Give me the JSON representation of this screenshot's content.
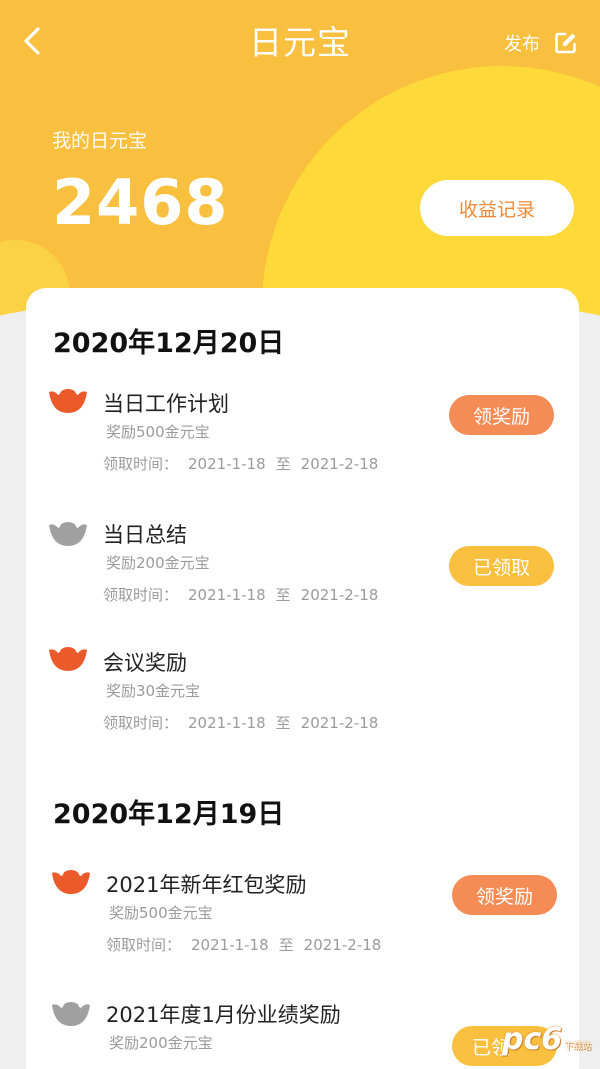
{
  "header": {
    "title": "日元宝",
    "publish_label": "发布",
    "balance_label": "我的日元宝",
    "balance_value": "2468",
    "earnings_button": "收益记录"
  },
  "colors": {
    "primary": "#f9bf3f",
    "highlight": "#fdd939",
    "claim": "#f58b55",
    "claimed": "#f9bf3f",
    "ingot_active": "#ea5a2a",
    "ingot_inactive": "#a0a0a0"
  },
  "groups": [
    {
      "date": "2020年12月20日",
      "items": [
        {
          "title": "当日工作计划",
          "reward": "奖励500金元宝",
          "time_label": "领取时间：",
          "start": "2021-1-18",
          "sep": "至",
          "end": "2021-2-18",
          "action": "领奖励",
          "status": "claim",
          "icon": "ingot-red-icon"
        },
        {
          "title": "当日总结",
          "reward": "奖励200金元宝",
          "time_label": "领取时间：",
          "start": "2021-1-18",
          "sep": "至",
          "end": "2021-2-18",
          "action": "已领取",
          "status": "claimed",
          "icon": "ingot-gray-icon"
        },
        {
          "title": "会议奖励",
          "reward": "奖励30金元宝",
          "time_label": "领取时间：",
          "start": "2021-1-18",
          "sep": "至",
          "end": "2021-2-18",
          "action": "",
          "status": "none",
          "icon": "ingot-red-icon"
        }
      ]
    },
    {
      "date": "2020年12月19日",
      "items": [
        {
          "title": "2021年新年红包奖励",
          "reward": "奖励500金元宝",
          "time_label": "领取时间：",
          "start": "2021-1-18",
          "sep": "至",
          "end": "2021-2-18",
          "action": "领奖励",
          "status": "claim",
          "icon": "ingot-red-icon"
        },
        {
          "title": "2021年度1月份业绩奖励",
          "reward": "奖励200金元宝",
          "time_label": "",
          "start": "",
          "sep": "",
          "end": "",
          "action": "已领",
          "status": "claimed",
          "icon": "ingot-gray-icon"
        }
      ]
    }
  ],
  "watermark": {
    "text": "pc6",
    "sub": "下载站"
  }
}
